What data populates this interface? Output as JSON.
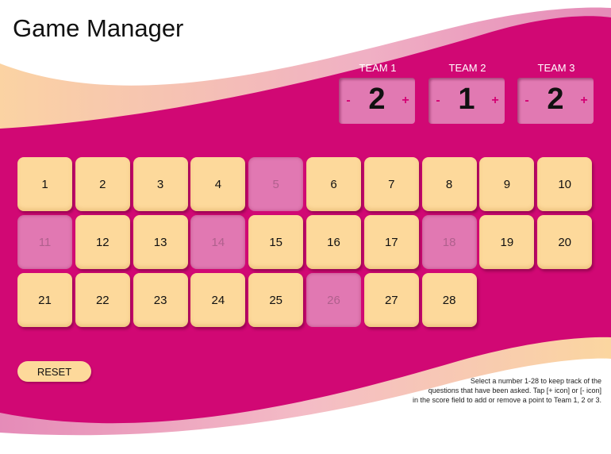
{
  "title": "Game Manager",
  "colors": {
    "background": "#d10874",
    "tile": "#fdd99b",
    "tile_used": "#e178b2",
    "score_box": "#e179b2",
    "score_control": "#d40073",
    "wave_light": "#fbd6a0",
    "wave_pink": "#e58bb8"
  },
  "teams": [
    {
      "label": "TEAM 1",
      "minus": "-",
      "score": "2",
      "plus": "+"
    },
    {
      "label": "TEAM 2",
      "minus": "-",
      "score": "1",
      "plus": "+"
    },
    {
      "label": "TEAM 3",
      "minus": "-",
      "score": "2",
      "plus": "+"
    }
  ],
  "tiles": [
    {
      "number": "1",
      "used": false
    },
    {
      "number": "2",
      "used": false
    },
    {
      "number": "3",
      "used": false
    },
    {
      "number": "4",
      "used": false
    },
    {
      "number": "5",
      "used": true
    },
    {
      "number": "6",
      "used": false
    },
    {
      "number": "7",
      "used": false
    },
    {
      "number": "8",
      "used": false
    },
    {
      "number": "9",
      "used": false
    },
    {
      "number": "10",
      "used": false
    },
    {
      "number": "11",
      "used": true
    },
    {
      "number": "12",
      "used": false
    },
    {
      "number": "13",
      "used": false
    },
    {
      "number": "14",
      "used": true
    },
    {
      "number": "15",
      "used": false
    },
    {
      "number": "16",
      "used": false
    },
    {
      "number": "17",
      "used": false
    },
    {
      "number": "18",
      "used": true
    },
    {
      "number": "19",
      "used": false
    },
    {
      "number": "20",
      "used": false
    },
    {
      "number": "21",
      "used": false
    },
    {
      "number": "22",
      "used": false
    },
    {
      "number": "23",
      "used": false
    },
    {
      "number": "24",
      "used": false
    },
    {
      "number": "25",
      "used": false
    },
    {
      "number": "26",
      "used": true
    },
    {
      "number": "27",
      "used": false
    },
    {
      "number": "28",
      "used": false
    }
  ],
  "reset_label": "RESET",
  "instructions": [
    "Select a number 1-28 to keep track of the",
    "questions that have been asked. Tap [+ icon] or [- icon]",
    "in the score field to add or remove a point to Team 1, 2 or 3."
  ]
}
